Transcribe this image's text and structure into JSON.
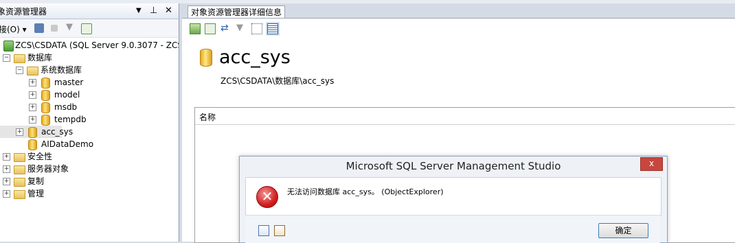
{
  "object_explorer": {
    "title": "象资源管理器",
    "connect_label": "接(O)",
    "tree": {
      "server": "ZCS\\CSDATA (SQL Server 9.0.3077 - ZCS\\",
      "databases": "数据库",
      "system_databases": "系统数据库",
      "system_dbs": [
        "master",
        "model",
        "msdb",
        "tempdb"
      ],
      "user_dbs": [
        "acc_sys",
        "AIDataDemo"
      ],
      "security": "安全性",
      "server_objects": "服务器对象",
      "replication": "复制",
      "management": "管理"
    }
  },
  "details": {
    "tab_label": "对象资源管理器详细信息",
    "title": "acc_sys",
    "path": "ZCS\\CSDATA\\数据库\\acc_sys",
    "column_name": "名称"
  },
  "dialog": {
    "title": "Microsoft SQL Server Management Studio",
    "close_label": "x",
    "error_message": "无法访问数据库 acc_sys。 (ObjectExplorer)",
    "ok_label": "确定",
    "error_glyph": "✕"
  },
  "icons": {
    "pin": "ᚋ",
    "close": "✕",
    "dropdown": "▼"
  }
}
